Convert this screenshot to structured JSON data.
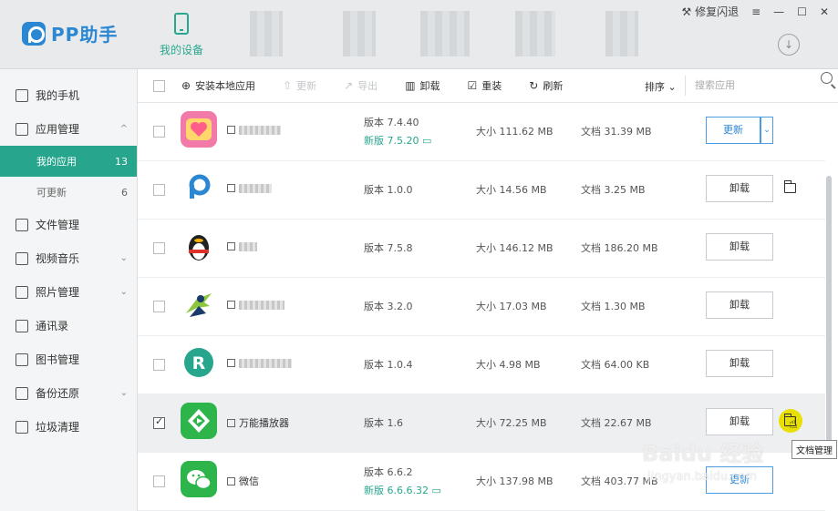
{
  "app": {
    "logo_text": "PP助手"
  },
  "nav": {
    "device_label": "我的设备"
  },
  "window": {
    "repair_label": "修复闪退",
    "menu": "≡",
    "minimize": "—",
    "maximize": "☐",
    "close": "✕",
    "download": "↓"
  },
  "sidebar": {
    "items": [
      {
        "label": "我的手机",
        "icon": "phone-icon"
      },
      {
        "label": "应用管理",
        "icon": "apps-icon",
        "chevron": "^"
      },
      {
        "label": "文件管理",
        "icon": "folder-icon"
      },
      {
        "label": "视频音乐",
        "icon": "video-icon",
        "chevron": "⌄"
      },
      {
        "label": "照片管理",
        "icon": "photo-icon",
        "chevron": "⌄"
      },
      {
        "label": "通讯录",
        "icon": "contacts-icon"
      },
      {
        "label": "图书管理",
        "icon": "book-icon"
      },
      {
        "label": "备份还原",
        "icon": "backup-icon",
        "chevron": "⌄"
      },
      {
        "label": "垃圾清理",
        "icon": "trash-icon"
      }
    ],
    "sub_my_apps": {
      "label": "我的应用",
      "count": "13"
    },
    "sub_updatable": {
      "label": "可更新",
      "count": "6"
    }
  },
  "toolbar": {
    "install_label": "安装本地应用",
    "update_label": "更新",
    "export_label": "导出",
    "uninstall_label": "卸载",
    "reinstall_label": "重装",
    "refresh_label": "刷新",
    "sort_label": "排序",
    "search_placeholder": "搜索应用"
  },
  "apps": [
    {
      "name": "",
      "version": "版本 7.4.40",
      "new_version": "新版 7.5.20",
      "size": "大小 111.62 MB",
      "docs": "文档 31.39 MB",
      "action": "更新"
    },
    {
      "name": "",
      "version": "版本 1.0.0",
      "new_version": "",
      "size": "大小 14.56 MB",
      "docs": "文档 3.25 MB",
      "action": "卸载"
    },
    {
      "name": "",
      "version": "版本 7.5.8",
      "new_version": "",
      "size": "大小 146.12 MB",
      "docs": "文档 186.20 MB",
      "action": "卸载"
    },
    {
      "name": "",
      "version": "版本 3.2.0",
      "new_version": "",
      "size": "大小 17.03 MB",
      "docs": "文档 1.30 MB",
      "action": "卸载"
    },
    {
      "name": "",
      "version": "版本 1.0.4",
      "new_version": "",
      "size": "大小 4.98 MB",
      "docs": "文档 64.00 KB",
      "action": "卸载"
    },
    {
      "name": "万能播放器",
      "version": "版本 1.6",
      "new_version": "",
      "size": "大小 72.25 MB",
      "docs": "文档 22.67 MB",
      "action": "卸载"
    },
    {
      "name": "微信",
      "version": "版本 6.6.2",
      "new_version": "新版 6.6.6.32",
      "size": "大小 137.98 MB",
      "docs": "文档 403.77 MB",
      "action": "更新"
    }
  ],
  "tooltip": "文档管理",
  "watermark": {
    "main": "Baidu 经验",
    "sub": "jingyan.baidu.com"
  }
}
